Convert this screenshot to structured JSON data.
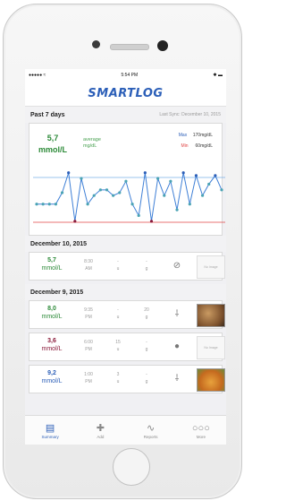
{
  "status": {
    "carrier": "●●●●● ≈",
    "time": "5:54 PM",
    "battery": "✱ ▬"
  },
  "app": {
    "title": "SMARTLOG"
  },
  "summary": {
    "period": "Past 7 days",
    "sync": "Last Sync: December 10, 2015",
    "avg_value": "5,7",
    "avg_unit": "mmol/L",
    "avg_label": "average",
    "avg_sublabel": "mg/dL",
    "max_key": "Max",
    "max_value": "170mg/dL",
    "min_key": "Min",
    "min_value": "60mg/dL"
  },
  "colors": {
    "brand": "#2c5fb8",
    "normal": "#2c8a38",
    "high": "#8b1a3a",
    "line": "#3e7fd6",
    "marker": "#4aa3b4",
    "min_line": "#e04545",
    "max_line": "#7ab0e6"
  },
  "chart_data": {
    "type": "line",
    "ylim": [
      60,
      170
    ],
    "max": 170,
    "min": 60,
    "series": [
      {
        "values": [
          95,
          95,
          95,
          95,
          115,
          150,
          65,
          140,
          95,
          110,
          120,
          120,
          110,
          115,
          135,
          95,
          75,
          150,
          65,
          140,
          110,
          135,
          85,
          150,
          95,
          145,
          110,
          130,
          145,
          120
        ]
      }
    ]
  },
  "days": [
    {
      "label": "December 10, 2015",
      "entries": [
        {
          "value": "5,7",
          "unit": "mmol/L",
          "color": "normal",
          "time": "8:30",
          "ampm": "AM",
          "c1": "-",
          "c1u": "u",
          "c2": "-",
          "c2u": "g",
          "icon": "no-meal-icon",
          "glyph": "⊘",
          "photo": "none",
          "thumb": "No Image"
        }
      ]
    },
    {
      "label": "December 9, 2015",
      "entries": [
        {
          "value": "8,0",
          "unit": "mmol/L",
          "color": "normal",
          "time": "9:35",
          "ampm": "PM",
          "c1": "-",
          "c1u": "u",
          "c2": "20",
          "c2u": "g",
          "icon": "snack-icon",
          "glyph": "⸸",
          "photo": "photo1",
          "thumb": ""
        },
        {
          "value": "3,6",
          "unit": "mmol/L",
          "color": "high",
          "time": "6:00",
          "ampm": "PM",
          "c1": "15",
          "c1u": "u",
          "c2": "-",
          "c2u": "g",
          "icon": "apple-icon",
          "glyph": "●",
          "photo": "none",
          "thumb": "No Image"
        },
        {
          "value": "9,2",
          "unit": "mmol/L",
          "color": "brand",
          "time": "1:00",
          "ampm": "PM",
          "c1": "3",
          "c1u": "u",
          "c2": "-",
          "c2u": "g",
          "icon": "snack-icon",
          "glyph": "⸸",
          "photo": "photo2",
          "thumb": ""
        }
      ]
    }
  ],
  "tabs": [
    {
      "label": "Summary",
      "icon": "clipboard-icon",
      "glyph": "▤",
      "active": true
    },
    {
      "label": "Add",
      "icon": "add-icon",
      "glyph": "✚",
      "active": false
    },
    {
      "label": "Reports",
      "icon": "reports-icon",
      "glyph": "∿",
      "active": false
    },
    {
      "label": "More",
      "icon": "more-icon",
      "glyph": "○○○",
      "active": false
    }
  ]
}
